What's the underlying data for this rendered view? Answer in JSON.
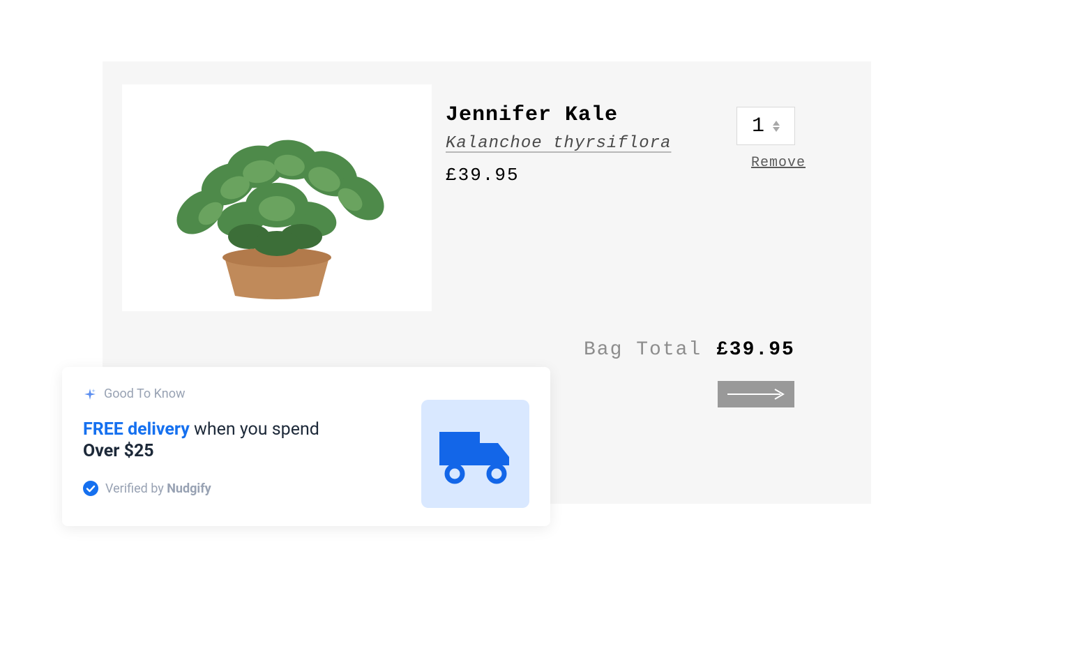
{
  "cart": {
    "product": {
      "title": "Jennifer Kale",
      "subtitle": "Kalanchoe thyrsiflora",
      "price": "£39.95",
      "quantity": "1",
      "remove_label": "Remove"
    },
    "bag_total_label": "Bag Total",
    "bag_total_value": "£39.95"
  },
  "nudge": {
    "header": "Good To Know",
    "free_label": "FREE delivery",
    "remainder_line1": " when you spend",
    "line2": "Over $25",
    "verified_prefix": "Verified by ",
    "verified_brand": "Nudgify"
  }
}
